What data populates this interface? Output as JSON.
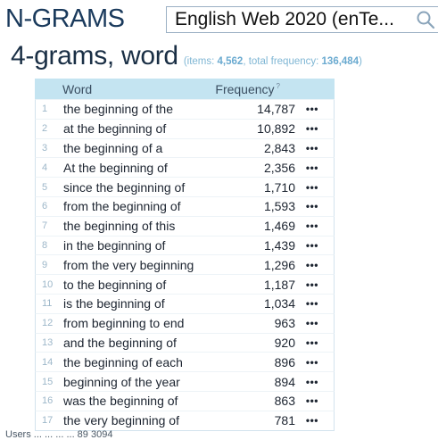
{
  "app": {
    "title": "N-GRAMS"
  },
  "corpus": {
    "selected": "English Web 2020 (enTe..."
  },
  "heading": {
    "title": "4-grams, word",
    "items_label": "(items: ",
    "items": "4,562",
    "freq_label": ", total frequency: ",
    "total": "136,484",
    "close": ")"
  },
  "table": {
    "col_word": "Word",
    "col_freq": "Frequency",
    "col_freq_hint": "?",
    "more_glyph": "•••",
    "rows": [
      {
        "n": "1",
        "text": "the beginning of the",
        "freq": "14,787"
      },
      {
        "n": "2",
        "text": "at the beginning of",
        "freq": "10,892"
      },
      {
        "n": "3",
        "text": "the beginning of a",
        "freq": "2,843"
      },
      {
        "n": "4",
        "text": "At the beginning of",
        "freq": "2,356"
      },
      {
        "n": "5",
        "text": "since the beginning of",
        "freq": "1,710"
      },
      {
        "n": "6",
        "text": "from the beginning of",
        "freq": "1,593"
      },
      {
        "n": "7",
        "text": "the beginning of this",
        "freq": "1,469"
      },
      {
        "n": "8",
        "text": "in the beginning of",
        "freq": "1,439"
      },
      {
        "n": "9",
        "text": "from the very beginning",
        "freq": "1,296"
      },
      {
        "n": "10",
        "text": "to the beginning of",
        "freq": "1,187"
      },
      {
        "n": "11",
        "text": "is the beginning of",
        "freq": "1,034"
      },
      {
        "n": "12",
        "text": "from beginning to end",
        "freq": "963"
      },
      {
        "n": "13",
        "text": "and the beginning of",
        "freq": "920"
      },
      {
        "n": "14",
        "text": "the beginning of each",
        "freq": "896"
      },
      {
        "n": "15",
        "text": "beginning of the year",
        "freq": "894"
      },
      {
        "n": "16",
        "text": "was the beginning of",
        "freq": "863"
      },
      {
        "n": "17",
        "text": "the very beginning of",
        "freq": "781"
      }
    ]
  },
  "footer": {
    "text": "Users ... ... ... ... 89 3094"
  }
}
